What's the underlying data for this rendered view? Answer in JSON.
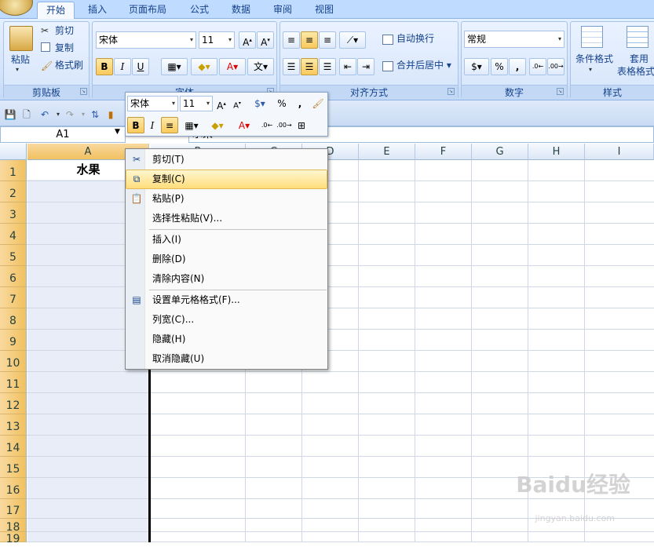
{
  "ribbon": {
    "tabs": [
      "开始",
      "插入",
      "页面布局",
      "公式",
      "数据",
      "审阅",
      "视图"
    ],
    "clipboard": {
      "paste": "粘贴",
      "cut": "剪切",
      "copy": "复制",
      "format_painter": "格式刷",
      "label": "剪贴板"
    },
    "font": {
      "name": "宋体",
      "size": "11",
      "label": "字体",
      "bold": "B",
      "italic": "I",
      "underline": "U"
    },
    "alignment": {
      "wrap": "自动换行",
      "merge": "合并后居中",
      "label": "对齐方式"
    },
    "number": {
      "format": "常规",
      "percent": "%",
      "comma": ",",
      "label": "数字"
    },
    "styles": {
      "conditional": "条件格式",
      "table_a": "套用",
      "table_b": "表格格式",
      "label": "样式"
    }
  },
  "formula_bar": {
    "name_box": "A1",
    "content": "水果"
  },
  "sheet": {
    "columns": [
      "A",
      "B",
      "C",
      "D",
      "E",
      "F",
      "G",
      "H",
      "I"
    ],
    "rows": [
      "1",
      "2",
      "3",
      "4",
      "5",
      "6",
      "7",
      "8",
      "9",
      "10",
      "11",
      "12",
      "13",
      "14",
      "15",
      "16",
      "17",
      "18",
      "19"
    ],
    "a1_value": "水果"
  },
  "mini_toolbar": {
    "font": "宋体",
    "size": "11",
    "percent": "%",
    "comma": ",",
    "bold": "B",
    "italic": "I"
  },
  "context_menu": {
    "items": [
      {
        "label": "剪切(T)",
        "icon": "scissors-icon"
      },
      {
        "label": "复制(C)",
        "icon": "copy-icon"
      },
      {
        "label": "粘贴(P)",
        "icon": "paste-icon"
      },
      {
        "label": "选择性粘贴(V)...",
        "icon": ""
      },
      {
        "label": "插入(I)",
        "icon": ""
      },
      {
        "label": "删除(D)",
        "icon": ""
      },
      {
        "label": "清除内容(N)",
        "icon": ""
      },
      {
        "label": "设置单元格格式(F)...",
        "icon": "format-cells-icon"
      },
      {
        "label": "列宽(C)...",
        "icon": ""
      },
      {
        "label": "隐藏(H)",
        "icon": ""
      },
      {
        "label": "取消隐藏(U)",
        "icon": ""
      }
    ]
  },
  "watermark": {
    "brand": "Baidu经验",
    "url": "jingyan.baidu.com"
  }
}
